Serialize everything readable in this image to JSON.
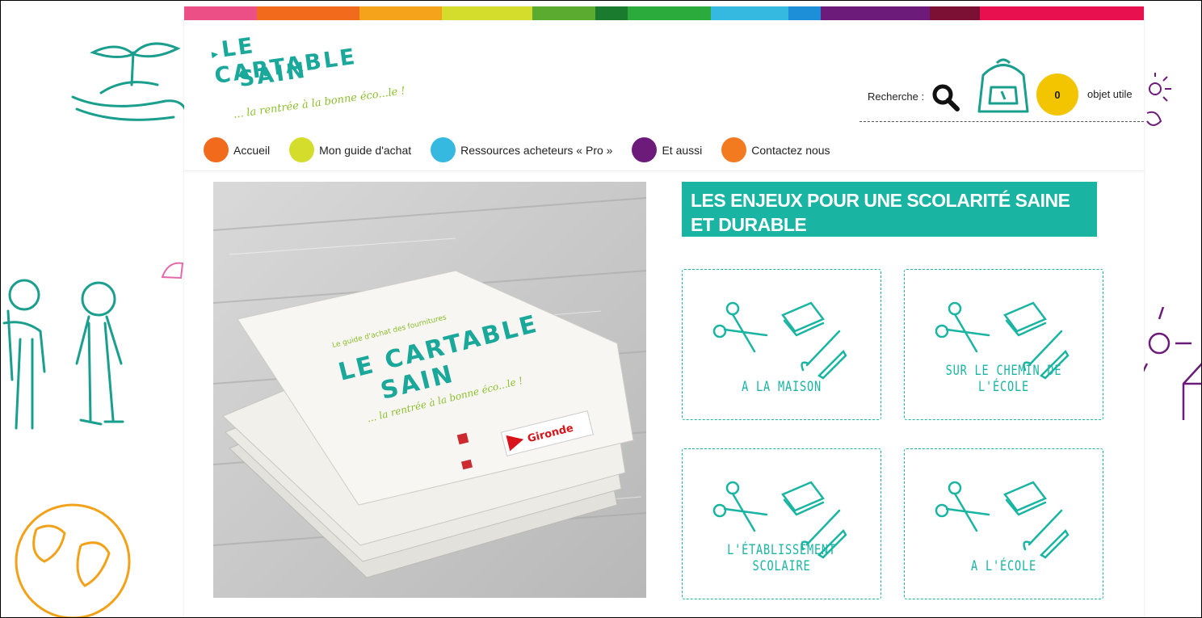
{
  "colors": {
    "accent": "#1ab5a2",
    "colorbar": [
      "#ec4f86",
      "#f26b1d",
      "#f5a31a",
      "#f4c400",
      "#d4dc2c",
      "#8ac23f",
      "#5aab2f",
      "#1a7a2e",
      "#2bab3c",
      "#36b9e0",
      "#1d8fd8",
      "#6d1b7a",
      "#7a1a62",
      "#7b1034",
      "#e8104e"
    ]
  },
  "logo": {
    "line1": "LE CARTABLE",
    "line2": "SAIN",
    "tagline": "... la rentrée à la bonne éco...le !"
  },
  "header": {
    "search_label": "Recherche :",
    "search_icon": "search-icon",
    "bag_icon": "backpack-icon",
    "count": "0",
    "count_label": "objet utile"
  },
  "nav": {
    "items": [
      {
        "label": "Accueil",
        "color": "#f26b1d"
      },
      {
        "label": "Mon guide d'achat",
        "color": "#d4dc2c"
      },
      {
        "label": "Ressources acheteurs « Pro »",
        "color": "#36b9e0"
      },
      {
        "label": "Et aussi",
        "color": "#6d1b7a"
      },
      {
        "label": "Contactez nous",
        "color": "#f47a20"
      }
    ]
  },
  "hero": {
    "brochure_line1": "LE CARTABLE",
    "brochure_line2": "SAIN",
    "brochure_small": "Le guide d'achat des fournitures",
    "brochure_tagline": "... la rentrée à la bonne éco...le !",
    "sponsor": "Gironde"
  },
  "section": {
    "title": "Les enjeux pour une scolarité saine et durable"
  },
  "cards": [
    {
      "label": "A la maison"
    },
    {
      "label": "Sur le chemin de l'école"
    },
    {
      "label": "L'établissement scolaire"
    },
    {
      "label": "A l'école"
    }
  ]
}
